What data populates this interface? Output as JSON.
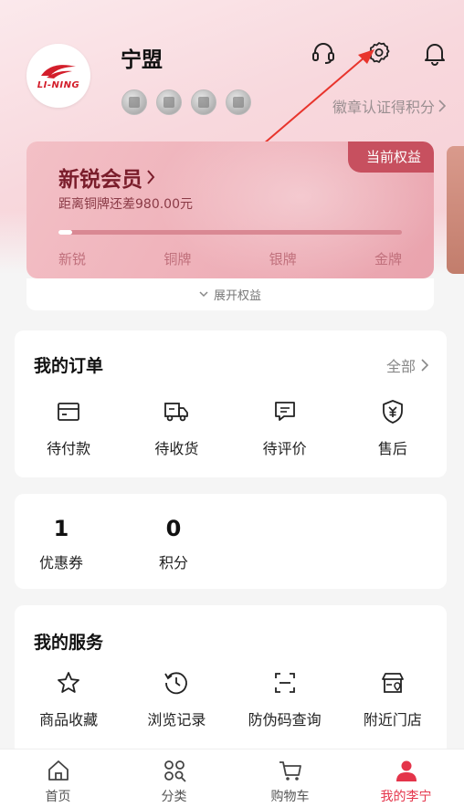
{
  "user": {
    "name": "宁盟",
    "logo_text": "LI-NING",
    "badges": [
      "badge-1",
      "badge-2",
      "badge-3",
      "badge-4"
    ],
    "badge_link": "徽章认证得积分"
  },
  "header_icons": [
    "headset-icon",
    "gear-icon",
    "bell-icon"
  ],
  "member": {
    "level": "新锐会员",
    "tag": "当前权益",
    "progress_text": "距离铜牌还差980.00元",
    "progress_fraction": 0.04,
    "levels": [
      "新锐",
      "铜牌",
      "银牌",
      "金牌"
    ],
    "expand": "展开权益"
  },
  "orders": {
    "title": "我的订单",
    "all": "全部",
    "items": [
      {
        "label": "待付款",
        "icon": "wallet-icon"
      },
      {
        "label": "待收货",
        "icon": "truck-icon"
      },
      {
        "label": "待评价",
        "icon": "comment-icon"
      },
      {
        "label": "售后",
        "icon": "shield-yen-icon"
      }
    ]
  },
  "stats": [
    {
      "value": "1",
      "label": "优惠券"
    },
    {
      "value": "0",
      "label": "积分"
    }
  ],
  "services": {
    "title": "我的服务",
    "items": [
      {
        "label": "商品收藏",
        "icon": "star-icon"
      },
      {
        "label": "浏览记录",
        "icon": "history-icon"
      },
      {
        "label": "防伪码查询",
        "icon": "scan-icon"
      },
      {
        "label": "附近门店",
        "icon": "store-icon"
      }
    ]
  },
  "tabs": [
    {
      "label": "首页",
      "icon": "home-icon"
    },
    {
      "label": "分类",
      "icon": "category-icon"
    },
    {
      "label": "购物车",
      "icon": "cart-icon"
    },
    {
      "label": "我的李宁",
      "icon": "user-icon",
      "active": true
    }
  ],
  "colors": {
    "accent": "#e4344a",
    "card": "#eeaeb7",
    "tag": "#c7505f"
  }
}
